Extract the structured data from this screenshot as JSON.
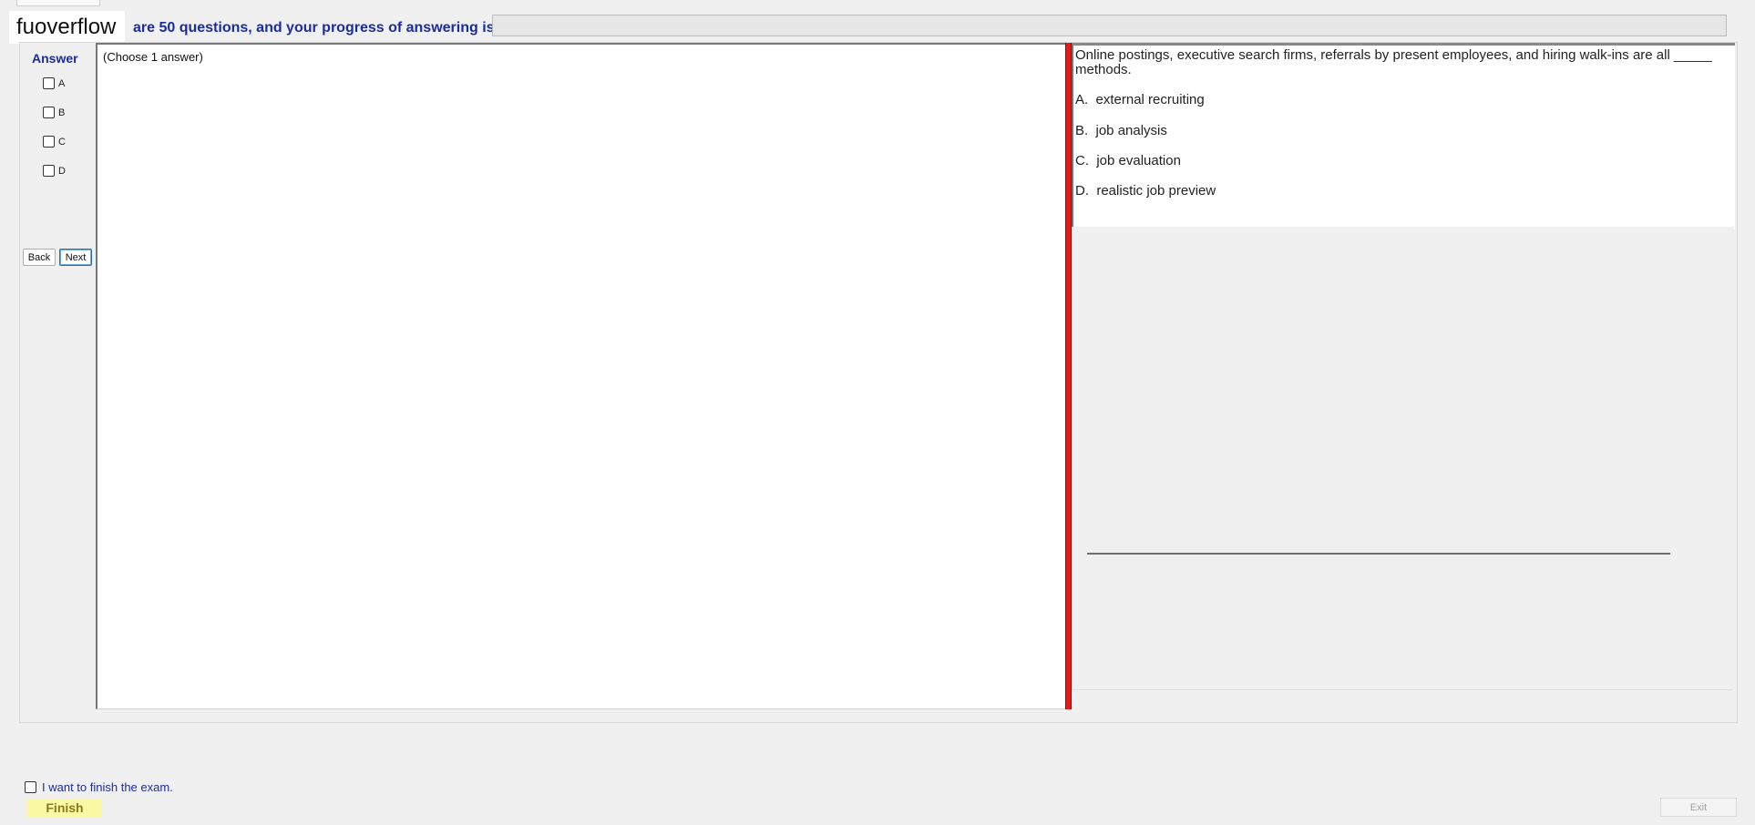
{
  "header": {
    "logo_text": "fuoverflow",
    "progress_text": "are 50 questions, and your progress of answering is",
    "progress_percent": 0
  },
  "answer_panel": {
    "heading": "Answer",
    "options": [
      "A",
      "B",
      "C",
      "D"
    ],
    "back_label": "Back",
    "next_label": "Next"
  },
  "left_panel": {
    "instruction": "(Choose 1 answer)"
  },
  "question": {
    "text": "Online postings, executive search firms, referrals by present employees, and hiring walk-ins are all _____ methods.",
    "options": [
      "A.  external recruiting",
      "B.  job analysis",
      "C.  job evaluation",
      "D.  realistic job preview"
    ]
  },
  "footer": {
    "finish_checkbox_label": "I want to finish the exam.",
    "finish_label": "Finish",
    "exit_label": "Exit"
  },
  "colors": {
    "accent_blue": "#1a2d9b",
    "splitter_red": "#e41b1b",
    "finish_yellow": "#fbf8a6"
  }
}
